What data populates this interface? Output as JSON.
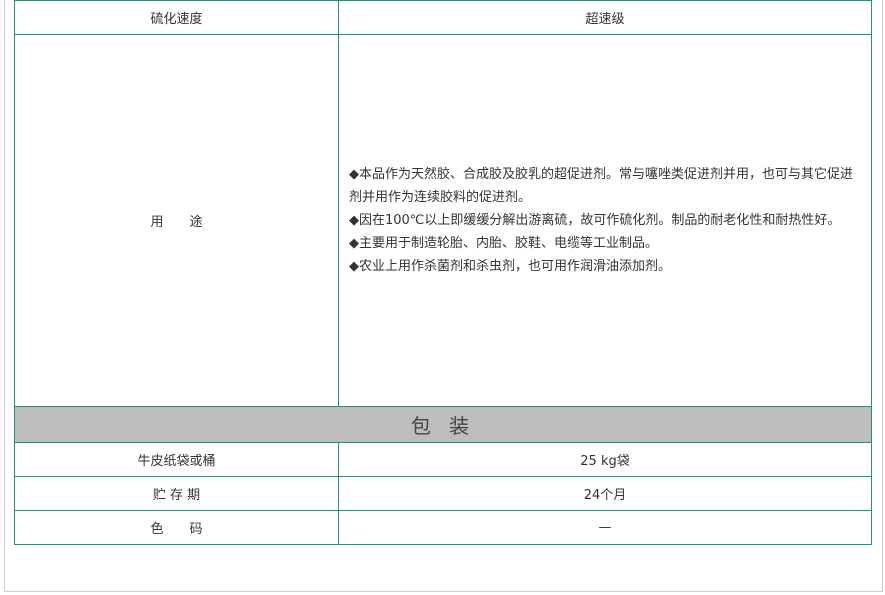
{
  "rows": {
    "cure_speed": {
      "label": "硫化速度",
      "value": "超速级"
    },
    "usage": {
      "label": "用　　途",
      "lines": [
        "◆本品作为天然胶、合成胶及胶乳的超促进剂。常与噻唑类促进剂并用，也可与其它促进剂并用作为连续胶料的促进剂。",
        "◆因在100℃以上即缓缓分解出游离硫，故可作硫化剂。制品的耐老化性和耐热性好。",
        "◆主要用于制造轮胎、内胎、胶鞋、电缆等工业制品。",
        "◆农业上用作杀菌剂和杀虫剂，也可用作润滑油添加剂。"
      ]
    }
  },
  "packaging": {
    "title": "包 装",
    "rows": [
      {
        "label": "牛皮纸袋或桶",
        "value": "25 kg袋"
      },
      {
        "label": "贮 存 期",
        "value": "24个月"
      },
      {
        "label": "色　　码",
        "value": "—"
      }
    ]
  },
  "colors": {
    "border": "#1a9a5e",
    "section_bg": "#bdbdbd"
  }
}
